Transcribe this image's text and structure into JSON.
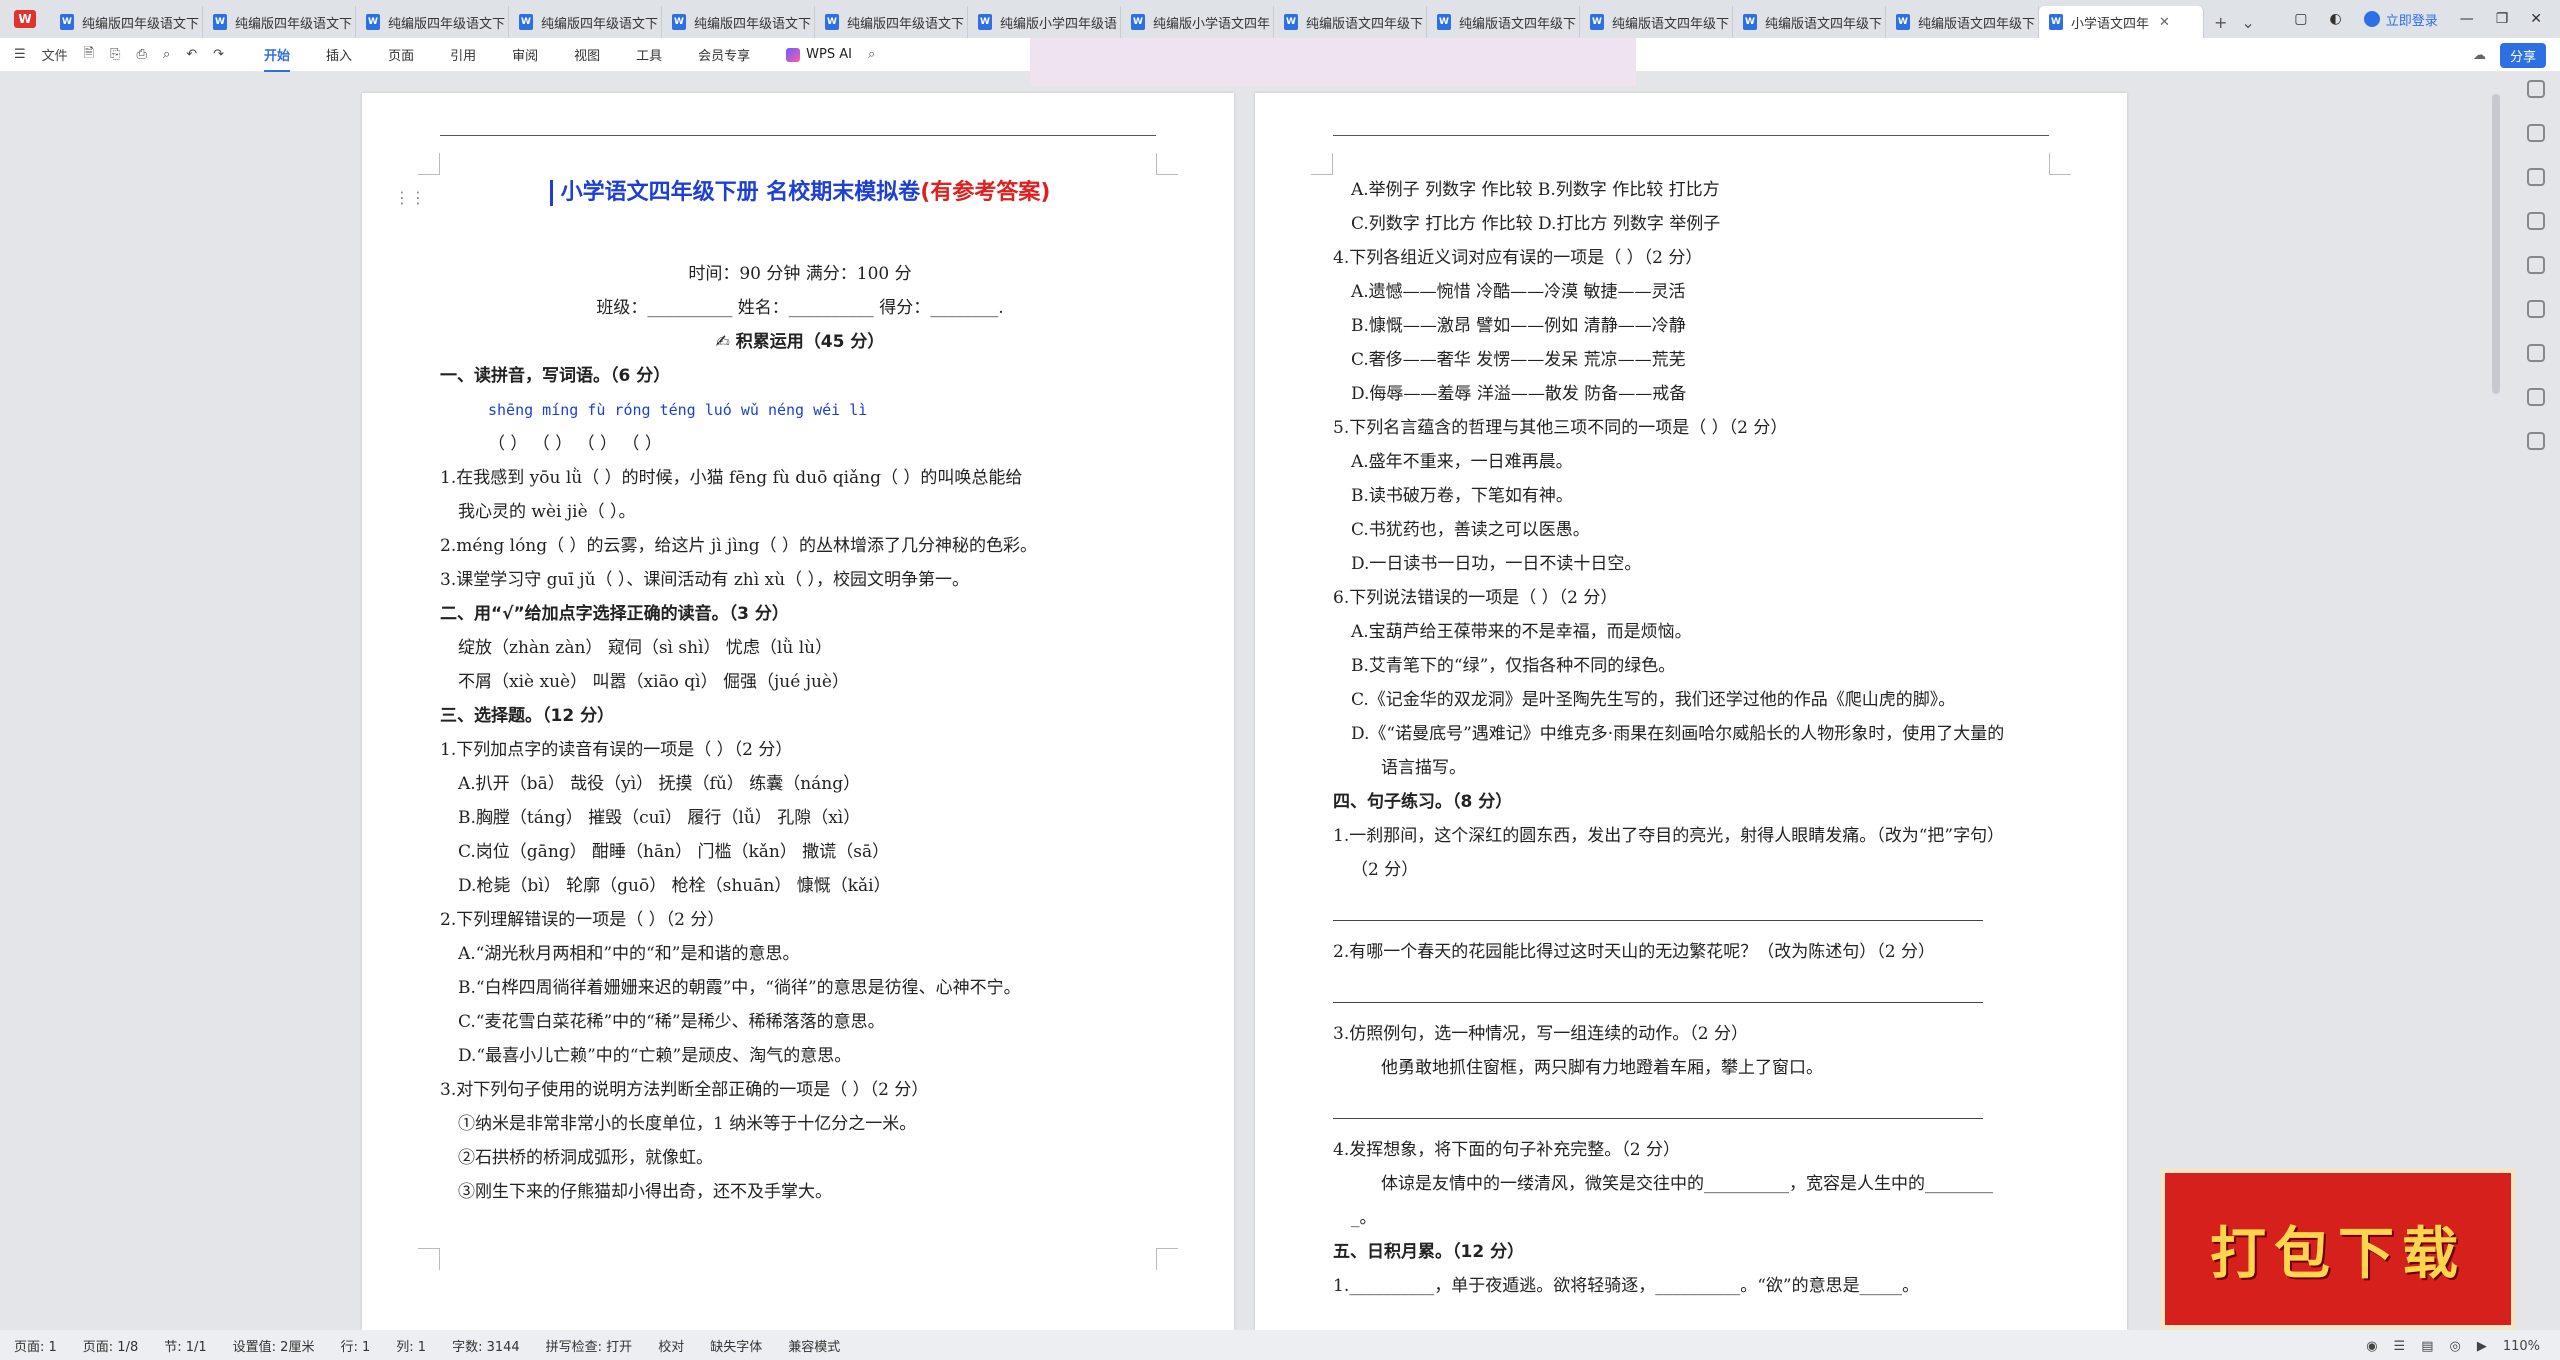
{
  "tabs": [
    "纯编版四年级语文下",
    "纯编版四年级语文下",
    "纯编版四年级语文下",
    "纯编版四年级语文下",
    "纯编版四年级语文下",
    "纯编版四年级语文下",
    "纯编版小学四年级语",
    "纯编版小学语文四年",
    "纯编版语文四年级下",
    "纯编版语文四年级下",
    "纯编版语文四年级下",
    "纯编版语文四年级下",
    "纯编版语文四年级下"
  ],
  "active_tab": "小学语文四年",
  "window": {
    "login": "立即登录"
  },
  "ribbon": {
    "file": "文件",
    "menu": [
      "开始",
      "插入",
      "页面",
      "引用",
      "审阅",
      "视图",
      "工具",
      "会员专享"
    ],
    "ai": "WPS AI",
    "share": "分享"
  },
  "page1": {
    "title_main": "小学语文四年级下册 名校期末模拟卷",
    "title_red": "(有参考答案)",
    "time_line": "时间：90 分钟  满分：100 分",
    "info_line": "班级：__________  姓名：__________  得分：________.",
    "section_head": "积累运用（45 分）",
    "lines": [
      {
        "t": "一、读拼音，写词语。（6 分）",
        "c": "sec"
      },
      {
        "t": "shēng míng        fù róng        téng luó        wǔ néng wéi lì",
        "c": "pin ind2"
      },
      {
        "t": "（        ）      （        ）      （        ）      （          ）",
        "c": "ind2"
      },
      {
        "t": "1.在我感到 yōu lǜ（        ）的时候，小猫 fēng fù duō qiǎng（          ）的叫唤总能给",
        "c": ""
      },
      {
        "t": "我心灵的 wèi jiè（        ）。",
        "c": "ind"
      },
      {
        "t": "2.méng lóng（        ）的云雾，给这片 jì jìng（        ）的丛林增添了几分神秘的色彩。",
        "c": ""
      },
      {
        "t": "3.课堂学习守 guī jǔ（        ）、课间活动有 zhì xù（        ），校园文明争第一。",
        "c": ""
      },
      {
        "t": "二、用“√”给加点字选择正确的读音。（3 分）",
        "c": "sec"
      },
      {
        "t": "绽放（zhàn  zàn）     窥伺（sì  shì）     忧虑（lǜ  lù）",
        "c": "ind"
      },
      {
        "t": "不屑（xiè  xuè）     叫嚣（xiāo  qì）     倔强（jué  juè）",
        "c": "ind"
      },
      {
        "t": "三、选择题。（12 分）",
        "c": "sec"
      },
      {
        "t": "1.下列加点字的读音有误的一项是（    ）（2 分）",
        "c": ""
      },
      {
        "t": "A.扒开（bā）     哉役（yì）     抚摸（fǔ）     练囊（náng）",
        "c": "ind"
      },
      {
        "t": "B.胸膛（táng）   摧毁（cuī）    履行（lǚ）     孔隙（xì）",
        "c": "ind"
      },
      {
        "t": "C.岗位（gāng）   酣睡（hān）    门槛（kǎn）    撒谎（sā）",
        "c": "ind"
      },
      {
        "t": "D.枪毙（bì）     轮廓（guō）    枪栓（shuān）  慷慨（kǎi）",
        "c": "ind"
      },
      {
        "t": "2.下列理解错误的一项是（    ）（2 分）",
        "c": ""
      },
      {
        "t": "A.“湖光秋月两相和”中的“和”是和谐的意思。",
        "c": "ind"
      },
      {
        "t": "B.“白桦四周徜徉着姗姗来迟的朝霞”中，“徜徉”的意思是彷徨、心神不宁。",
        "c": "ind"
      },
      {
        "t": "C.“麦花雪白菜花稀”中的“稀”是稀少、稀稀落落的意思。",
        "c": "ind"
      },
      {
        "t": "D.“最喜小儿亡赖”中的“亡赖”是顽皮、淘气的意思。",
        "c": "ind"
      },
      {
        "t": "3.对下列句子使用的说明方法判断全部正确的一项是（    ）（2 分）",
        "c": ""
      },
      {
        "t": "①纳米是非常非常小的长度单位，1 纳米等于十亿分之一米。",
        "c": "ind"
      },
      {
        "t": "②石拱桥的桥洞成弧形，就像虹。",
        "c": "ind"
      },
      {
        "t": "③刚生下来的仔熊猫却小得出奇，还不及手掌大。",
        "c": "ind"
      }
    ]
  },
  "page2": {
    "lines": [
      {
        "t": "A.举例子   列数字   作比较        B.列数字   作比较   打比方",
        "c": "ind"
      },
      {
        "t": "C.列数字   打比方   作比较        D.打比方   列数字   举例子",
        "c": "ind"
      },
      {
        "t": "4.下列各组近义词对应有误的一项是（    ）（2 分）",
        "c": ""
      },
      {
        "t": "A.遗憾——惋惜     冷酷——冷漠     敏捷——灵活",
        "c": "ind"
      },
      {
        "t": "B.慷慨——激昂     譬如——例如     清静——冷静",
        "c": "ind"
      },
      {
        "t": "C.奢侈——奢华     发愣——发呆     荒凉——荒芜",
        "c": "ind"
      },
      {
        "t": "D.侮辱——羞辱     洋溢——散发     防备——戒备",
        "c": "ind"
      },
      {
        "t": "5.下列名言蕴含的哲理与其他三项不同的一项是（    ）（2 分）",
        "c": ""
      },
      {
        "t": "A.盛年不重来，一日难再晨。",
        "c": "ind"
      },
      {
        "t": "B.读书破万卷，下笔如有神。",
        "c": "ind"
      },
      {
        "t": "C.书犹药也，善读之可以医愚。",
        "c": "ind"
      },
      {
        "t": "D.一日读书一日功，一日不读十日空。",
        "c": "ind"
      },
      {
        "t": "6.下列说法错误的一项是（    ）（2 分）",
        "c": ""
      },
      {
        "t": "A.宝葫芦给王葆带来的不是幸福，而是烦恼。",
        "c": "ind"
      },
      {
        "t": "B.艾青笔下的“绿”，仅指各种不同的绿色。",
        "c": "ind"
      },
      {
        "t": "C.《记金华的双龙洞》是叶圣陶先生写的，我们还学过他的作品《爬山虎的脚》。",
        "c": "ind"
      },
      {
        "t": "D.《“诺曼底号”遇难记》中维克多·雨果在刻画哈尔威船长的人物形象时，使用了大量的",
        "c": "ind"
      },
      {
        "t": "语言描写。",
        "c": "ind2"
      },
      {
        "t": "四、句子练习。（8 分）",
        "c": "sec"
      },
      {
        "t": "1.一刹那间，这个深红的圆东西，发出了夺目的亮光，射得人眼睛发痛。（改为“把”字句）",
        "c": ""
      },
      {
        "t": "（2 分）",
        "c": "ind"
      },
      {
        "t": "",
        "c": "ans"
      },
      {
        "t": "2.有哪一个春天的花园能比得过这时天山的无边繁花呢？（改为陈述句）（2 分）",
        "c": ""
      },
      {
        "t": "",
        "c": "ans"
      },
      {
        "t": "3.仿照例句，选一种情况，写一组连续的动作。（2 分）",
        "c": ""
      },
      {
        "t": "他勇敢地抓住窗框，两只脚有力地蹬着车厢，攀上了窗口。",
        "c": "ind2"
      },
      {
        "t": "",
        "c": "ans"
      },
      {
        "t": "4.发挥想象，将下面的句子补充完整。（2 分）",
        "c": ""
      },
      {
        "t": "体谅是友情中的一缕清风，微笑是交往中的__________，宽容是人生中的________",
        "c": "ind2"
      },
      {
        "t": "_。",
        "c": "ind"
      },
      {
        "t": "五、日积月累。（12 分）",
        "c": "sec"
      },
      {
        "t": "1.__________，单于夜遁逃。欲将轻骑逐，__________。“欲”的意思是_____。",
        "c": ""
      }
    ]
  },
  "status": {
    "page": "页面: 1",
    "pages": "页面: 1/8",
    "section": "节: 1/1",
    "setting": "设置值: 2厘米",
    "row": "行: 1",
    "col": "列: 1",
    "words": "字数: 3144",
    "spell": "拼写检查: 打开",
    "proof": "校对",
    "font": "缺失字体",
    "compat": "兼容模式",
    "zoom": "110%"
  },
  "download_badge": "打包下载"
}
